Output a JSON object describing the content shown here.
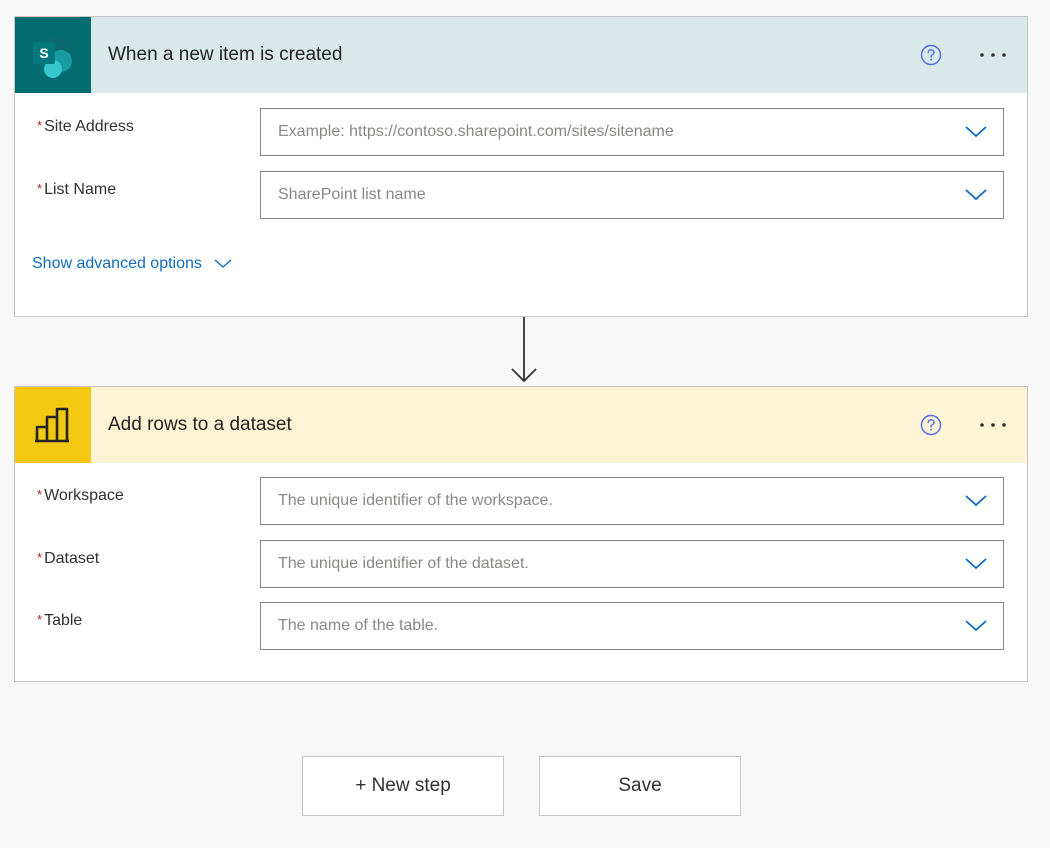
{
  "trigger": {
    "title": "When a new item is created",
    "icon": "sharepoint-icon",
    "icon_letter": "S",
    "accent": "#036c70",
    "header_bg": "#d9e8e8",
    "fields": [
      {
        "label": "Site Address",
        "placeholder": "Example: https://contoso.sharepoint.com/sites/sitename",
        "required_mark": "*"
      },
      {
        "label": "List Name",
        "placeholder": "SharePoint list name",
        "required_mark": "*"
      }
    ],
    "advanced_label": "Show advanced options"
  },
  "action": {
    "title": "Add rows to a dataset",
    "icon": "power-bi-icon",
    "accent": "#f2c811",
    "header_bg": "#fcf4d4",
    "fields": [
      {
        "label": "Workspace",
        "placeholder": "The unique identifier of the workspace.",
        "required_mark": "*"
      },
      {
        "label": "Dataset",
        "placeholder": "The unique identifier of the dataset.",
        "required_mark": "*"
      },
      {
        "label": "Table",
        "placeholder": "The name of the table.",
        "required_mark": "*"
      }
    ]
  },
  "buttons": {
    "new_step": "+ New step",
    "save": "Save"
  }
}
